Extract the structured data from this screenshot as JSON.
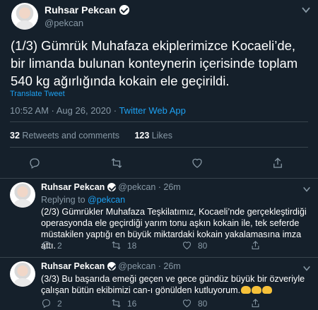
{
  "tweet": {
    "author": {
      "name": "Ruhsar Pekcan",
      "handle": "@pekcan"
    },
    "text": "(1/3) Gümrük Muhafaza ekiplerimizce Kocaeli’de, bir limanda bulunan konteynerin içerisinde toplam 540 kg ağırlığında kokain ele geçirildi.",
    "translate_label": "Translate Tweet",
    "timestamp": "10:52 AM · Aug 26, 2020 ·",
    "source": "Twitter Web App",
    "stats": {
      "retweets_count": "32",
      "retweets_label": "Retweets and comments",
      "likes_count": "123",
      "likes_label": "Likes"
    }
  },
  "replies": [
    {
      "name": "Ruhsar Pekcan",
      "meta": "@pekcan · 26m",
      "replying_label": "Replying to",
      "replying_handle": "@pekcan",
      "text": "(2/3) Gümrükler Muhafaza Teşkilatımız,  Kocaeli’nde gerçekleştirdiği operasyonda ele geçirdiği yarım tonu aşkın kokain ile, tek seferde müstakilen yaptığı en büyük miktardaki kokain yakalamasına imza attı.",
      "reply_count": "2",
      "retweet_count": "18",
      "like_count": "80"
    },
    {
      "name": "Ruhsar Pekcan",
      "meta": "@pekcan · 26m",
      "text": "(3/3) Bu başarıda emeği geçen ve gece gündüz büyük bir özveriyle çalışan bütün ekibimizi can-ı gönülden kutluyorum.",
      "reply_count": "2",
      "retweet_count": "16",
      "like_count": "80"
    }
  ],
  "icons": [
    "verified-icon",
    "chevron-down-icon",
    "reply-icon",
    "retweet-icon",
    "like-icon",
    "share-icon",
    "clap-emoji-icon"
  ],
  "colors": {
    "background": "#15202b",
    "accent": "#1da1f2",
    "muted": "#8899a6",
    "divider": "#38444d"
  }
}
